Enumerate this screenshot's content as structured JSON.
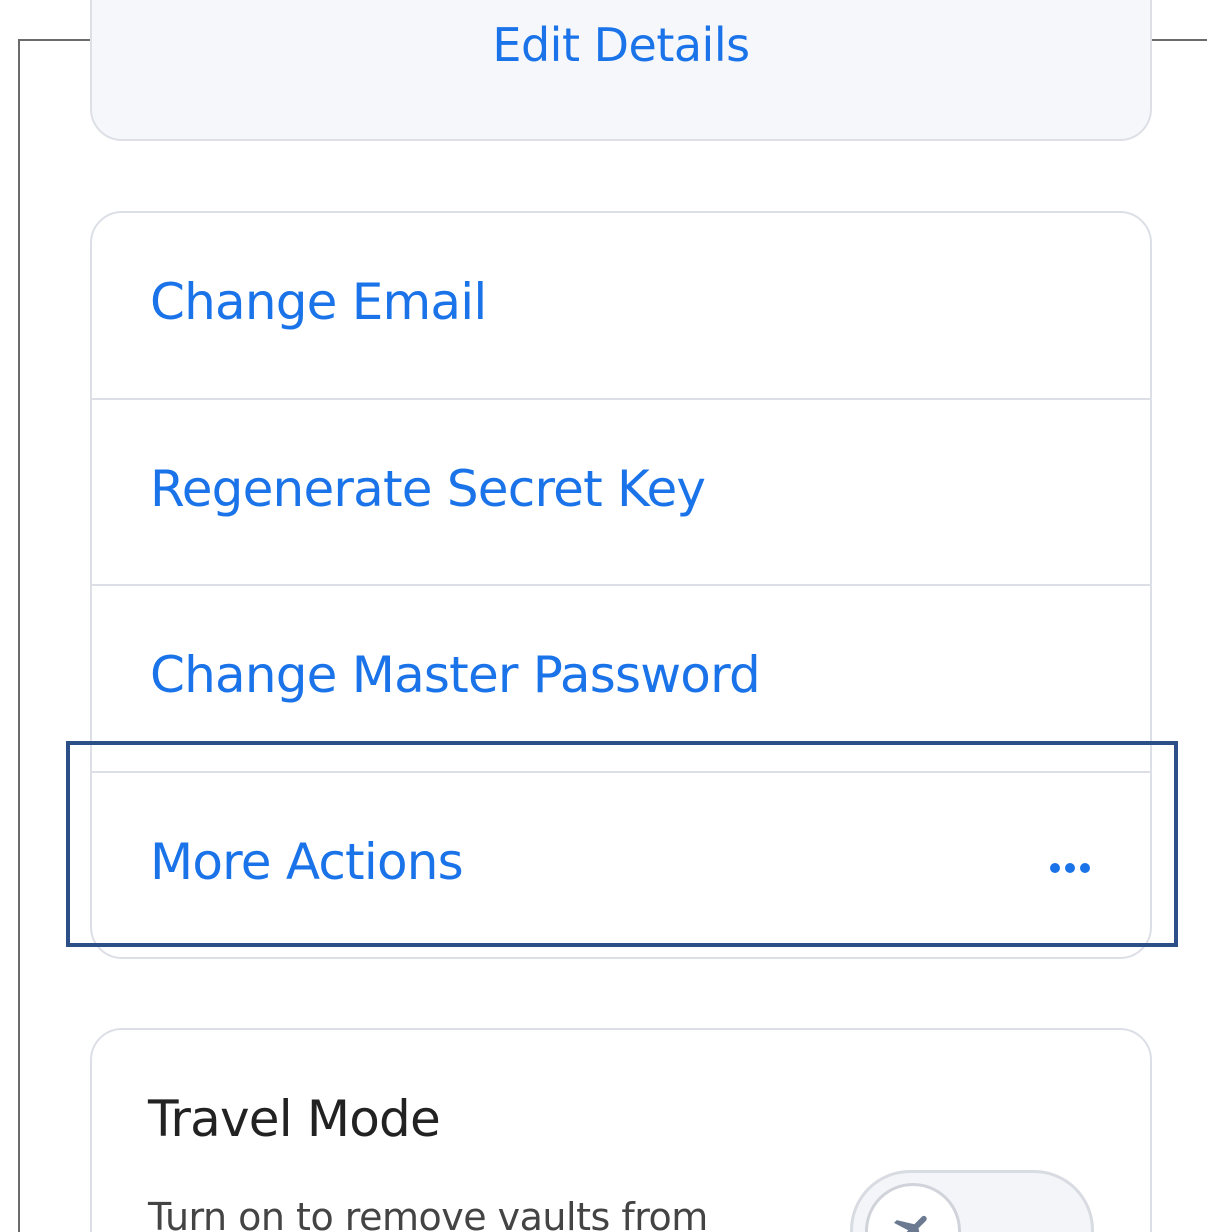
{
  "account_card": {
    "edit_details_label": "Edit Details"
  },
  "actions_card": {
    "items": [
      {
        "label": "Change Email"
      },
      {
        "label": "Regenerate Secret Key"
      },
      {
        "label": "Change Master Password"
      },
      {
        "label": "More Actions",
        "icon": "more-horizontal-icon"
      }
    ]
  },
  "travel_mode": {
    "title": "Travel Mode",
    "description": "Turn on to remove vaults from",
    "toggle": {
      "state": "off",
      "icon": "airplane-icon"
    }
  },
  "colors": {
    "link": "#1a73e8",
    "highlight_border": "#2b4f86",
    "card_border": "#dcdfe6"
  }
}
